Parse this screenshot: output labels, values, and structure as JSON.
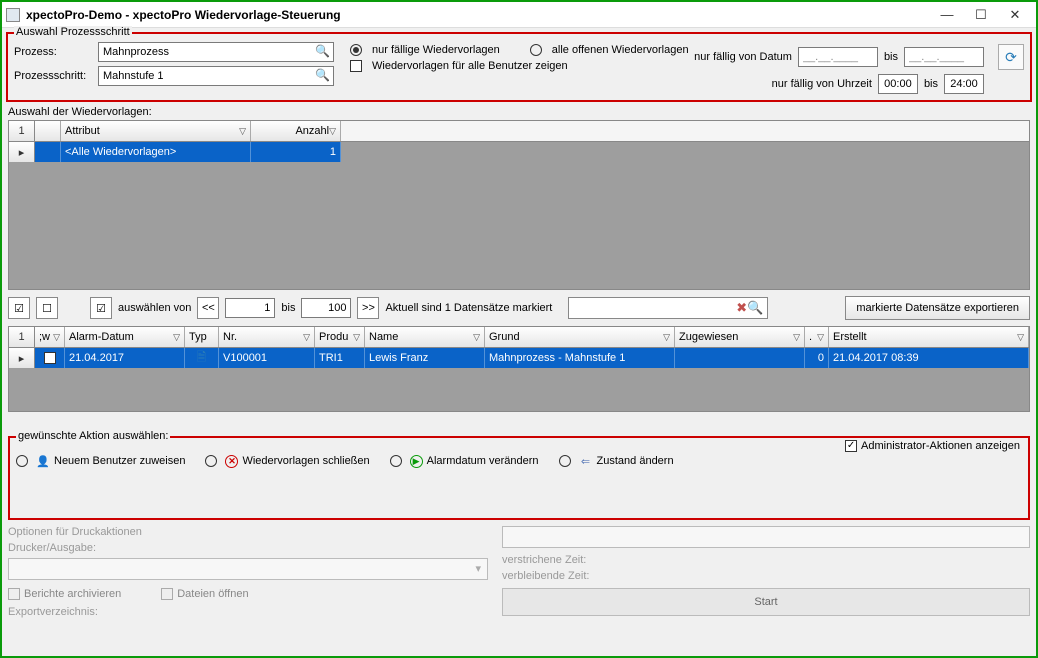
{
  "window": {
    "title": "xpectoPro-Demo - xpectoPro Wiedervorlage-Steuerung"
  },
  "top": {
    "legend": "Auswahl Prozessschritt",
    "prozess_label": "Prozess:",
    "prozess_value": "Mahnprozess",
    "schritt_label": "Prozessschritt:",
    "schritt_value": "Mahnstufe 1",
    "radio_faellig": "nur fällige Wiedervorlagen",
    "radio_alle": "alle offenen Wiedervorlagen",
    "chk_allusers": "Wiedervorlagen für alle Benutzer zeigen",
    "date_label": "nur fällig von Datum",
    "date_placeholder": "__.__.____",
    "bis": "bis",
    "time_label": "nur fällig von Uhrzeit",
    "time_from": "00:00",
    "time_to": "24:00"
  },
  "grid1": {
    "legend": "Auswahl der Wiedervorlagen:",
    "head_1": "1",
    "head_attr": "Attribut",
    "head_anzahl": "Anzahl",
    "row_attr": "<Alle Wiedervorlagen>",
    "row_anzahl": "1"
  },
  "toolbar": {
    "auswaehlen": "auswählen von",
    "from": "1",
    "bis": "bis",
    "to": "100",
    "status": "Aktuell sind 1 Datensätze markiert",
    "export": "markierte Datensätze exportieren"
  },
  "grid2": {
    "h1": "1",
    "hsw": ";w",
    "halarm": "Alarm-Datum",
    "htyp": "Typ",
    "hnr": "Nr.",
    "hprod": "Produ",
    "hname": "Name",
    "hgrund": "Grund",
    "hzug": "Zugewiesen",
    "hdot": ".",
    "herst": "Erstellt",
    "alarm": "21.04.2017",
    "nr": "V100001",
    "prod": "TRI1",
    "name": "Lewis Franz",
    "grund": "Mahnprozess - Mahnstufe 1",
    "zug": "",
    "dot": "0",
    "erst": "21.04.2017 08:39"
  },
  "actions": {
    "legend": "gewünschte Aktion auswählen:",
    "admin": "Administrator-Aktionen anzeigen",
    "a1": "Neuem Benutzer zuweisen",
    "a2": "Wiedervorlagen schließen",
    "a3": "Alarmdatum verändern",
    "a4": "Zustand ändern"
  },
  "bottom": {
    "opt": "Optionen für Druckaktionen",
    "drucker": "Drucker/Ausgabe:",
    "arch": "Berichte archivieren",
    "open": "Dateien öffnen",
    "export": "Exportverzeichnis:",
    "verstr": "verstrichene Zeit:",
    "verbl": "verbleibende Zeit:",
    "start": "Start"
  }
}
